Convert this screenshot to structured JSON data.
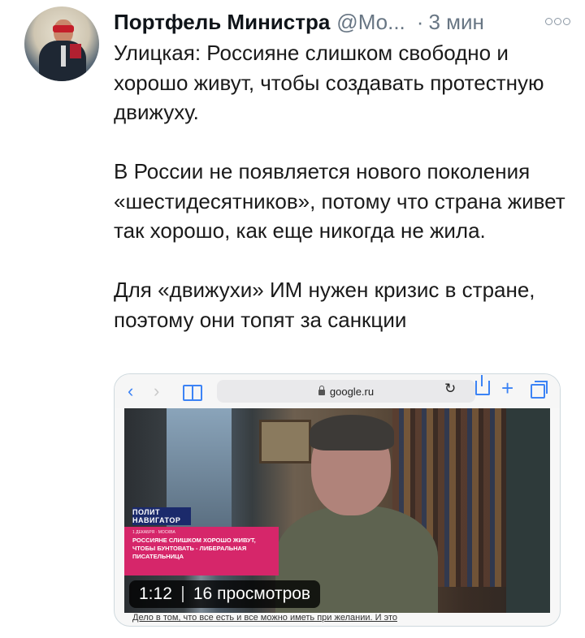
{
  "tweet": {
    "author_name": "Портфель Министра",
    "handle": "@Мо...",
    "separator": "·",
    "time": "3 мин",
    "paragraphs": [
      "Улицкая: Россияне слишком свободно и хорошо живут, чтобы создавать протестную движуху.",
      "В России не появляется нового поколения «шестидесятников», потому что страна живет так хорошо, как еще никогда не жила.",
      "Для «движухи» ИМ нужен кризис в стране, поэтому они топят за санкции"
    ]
  },
  "icons": {
    "more": "more-icon",
    "back": "chevron-left-icon",
    "forward": "chevron-right-icon",
    "bookmarks": "book-icon",
    "lock": "lock-icon",
    "reload": "reload-icon",
    "share": "share-icon",
    "add": "plus-icon",
    "tabs": "tabs-icon"
  },
  "browser": {
    "url": "google.ru",
    "back_glyph": "‹",
    "forward_glyph": "›",
    "reload_glyph": "↻",
    "add_glyph": "+"
  },
  "video": {
    "channel_logo": "ПОЛИТ НАВИГАТОР",
    "caption_date": "1 ДЕКАБРЯ · МОСКВА",
    "caption_text": "РОССИЯНЕ СЛИШКОМ ХОРОШО ЖИВУТ, ЧТОБЫ БУНТОВАТЬ - ЛИБЕРАЛЬНАЯ ПИСАТЕЛЬНИЦА",
    "duration": "1:12",
    "views": "16 просмотров"
  },
  "page_text_below": "Дело в том, что все есть и все можно иметь при желании. И это"
}
